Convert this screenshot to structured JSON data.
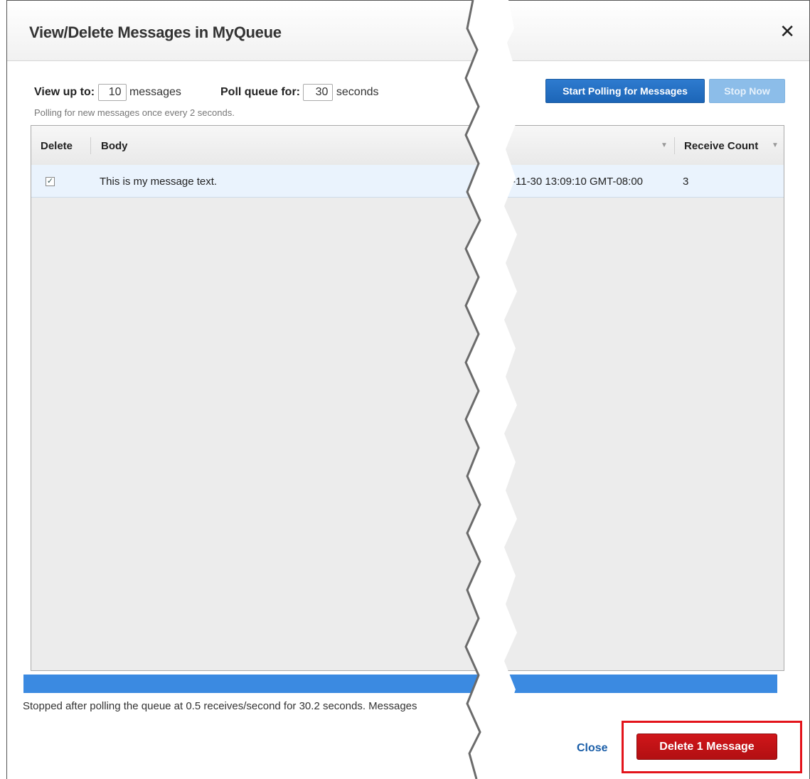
{
  "dialog": {
    "title": "View/Delete Messages in MyQueue",
    "close_glyph": "✕"
  },
  "controls": {
    "view_up_to_label": "View up to:",
    "view_up_to_value": "10",
    "messages_unit": "messages",
    "poll_queue_label": "Poll queue for:",
    "poll_queue_value": "30",
    "seconds_unit": "seconds",
    "hint": "Polling for new messages once every 2 seconds.",
    "start_button": "Start Polling for Messages",
    "stop_button": "Stop Now"
  },
  "table": {
    "columns": [
      "Delete",
      "Body",
      "Receive Count"
    ],
    "rows": [
      {
        "checked": true,
        "body": "This is my message text.",
        "sent": "-11-30 13:09:10 GMT-08:00",
        "receive_count": "3"
      }
    ]
  },
  "progress": {
    "fraction": 1.0,
    "color": "#3b8ae1"
  },
  "status_text": "Stopped after polling the queue at 0.5 receives/second for 30.2 seconds. Messages",
  "footer": {
    "close_label": "Close",
    "delete_label": "Delete 1 Message"
  },
  "icons": {
    "close": "close-icon",
    "checkbox": "checkbox-checked-icon",
    "sort": "sort-caret-icon"
  },
  "colors": {
    "primary": "#1c65b7",
    "danger": "#c41317",
    "highlight": "#e3141b"
  }
}
